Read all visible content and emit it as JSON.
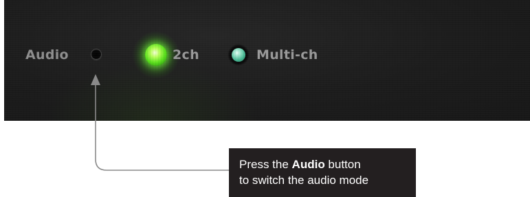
{
  "panel": {
    "labels": {
      "audio": "Audio",
      "two_ch": "2ch",
      "multi_ch": "Multi-ch"
    },
    "leds": {
      "two_ch": {
        "state": "on",
        "color": "#5ee21f"
      },
      "multi_ch": {
        "state": "off",
        "color": "#47b893"
      }
    }
  },
  "callout": {
    "line1_prefix": "Press the ",
    "line1_bold": "Audio",
    "line1_suffix": " button",
    "line2": "to switch the audio mode"
  },
  "colors": {
    "panel_background": "#1c1c1c",
    "label_text": "#8f8f8f",
    "callout_background": "#231f20",
    "callout_text": "#ffffff",
    "connector_line": "#8a8a8a"
  }
}
